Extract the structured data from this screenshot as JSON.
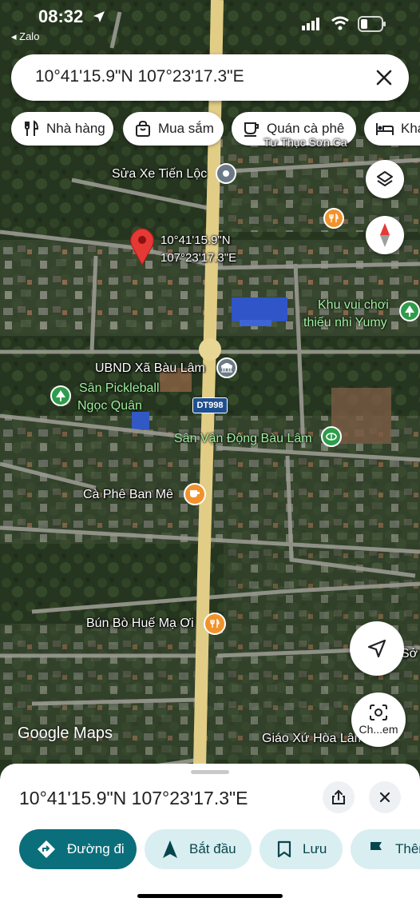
{
  "status_bar": {
    "time": "08:32",
    "back_app": "◂ Zalo"
  },
  "search": {
    "value": "10°41'15.9\"N 107°23'17.3\"E"
  },
  "chips": [
    {
      "label": "Nhà hàng",
      "icon": "fork-knife-icon"
    },
    {
      "label": "Mua sắm",
      "icon": "shopping-bag-icon"
    },
    {
      "label": "Quán cà phê",
      "icon": "coffee-cup-icon"
    },
    {
      "label": "Khác",
      "icon": "bed-icon"
    }
  ],
  "map": {
    "pin_label_line1": "10°41'15.9\"N",
    "pin_label_line2": "107°23'17.3\"E",
    "places": {
      "sua_xe": "Sửa Xe Tiến Lộc",
      "tu_thuc": "Tư Thục Sơn Ca",
      "khu_vui_choi_1": "Khu vui chơi",
      "khu_vui_choi_2": "thiếu nhi Yumy",
      "ubnd": "UBND Xã Bàu Lâm",
      "pickleball_1": "Sân Pickleball",
      "pickleball_2": "Ngọc Quân",
      "road_shield": "DT998",
      "san_van_dong": "Sân Vận Động Bàu Lâm",
      "ca_phe": "Cà Phê Ban Mê",
      "bun_bo": "Bún Bò Huế Mạ Ơi",
      "giao_xu": "Giáo Xứ Hòa Lâm",
      "so_edge": "Sở"
    },
    "watermark": "Google Maps",
    "lens_label": "Ch...em",
    "colors": {
      "road": "#e8d48f",
      "green_label": "#9ff09f",
      "pin_red": "#e53935",
      "food_orange": "#f2922c"
    }
  },
  "sheet": {
    "title": "10°41'15.9\"N 107°23'17.3\"E",
    "actions": [
      {
        "label": "Đường đi",
        "icon": "directions-icon"
      },
      {
        "label": "Bắt đầu",
        "icon": "navigation-arrow-icon"
      },
      {
        "label": "Lưu",
        "icon": "bookmark-icon"
      },
      {
        "label": "Thêm",
        "icon": "flag-icon"
      }
    ],
    "colors": {
      "primary": "#0b6e7b",
      "tonal": "#d9eef1"
    }
  }
}
